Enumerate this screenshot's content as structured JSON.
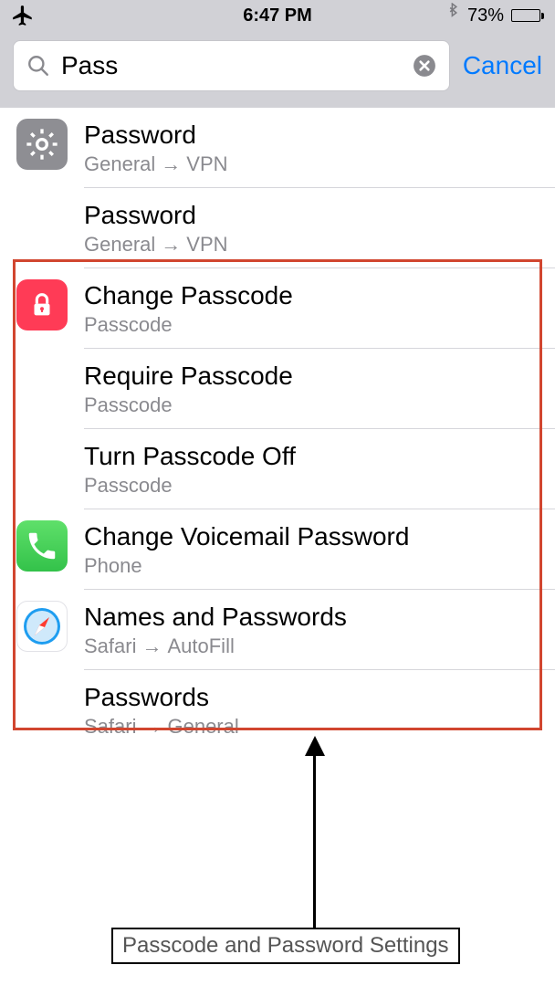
{
  "statusbar": {
    "time": "6:47 PM",
    "battery_percent": "73%"
  },
  "search": {
    "value": "Pass",
    "cancel": "Cancel"
  },
  "arrows": {
    "sep": "→"
  },
  "results": [
    {
      "icon": "gear",
      "title": "Password",
      "path1": "General",
      "path2": "VPN"
    },
    {
      "icon": "",
      "title": "Password",
      "path1": "General",
      "path2": "VPN"
    },
    {
      "icon": "lock",
      "title": "Change Passcode",
      "path1": "Passcode",
      "path2": ""
    },
    {
      "icon": "",
      "title": "Require Passcode",
      "path1": "Passcode",
      "path2": ""
    },
    {
      "icon": "",
      "title": "Turn Passcode Off",
      "path1": "Passcode",
      "path2": ""
    },
    {
      "icon": "phone",
      "title": "Change Voicemail Password",
      "path1": "Phone",
      "path2": ""
    },
    {
      "icon": "safari",
      "title": "Names and Passwords",
      "path1": "Safari",
      "path2": "AutoFill"
    },
    {
      "icon": "",
      "title": "Passwords",
      "path1": "Safari",
      "path2": "General"
    }
  ],
  "annotation": {
    "label": "Passcode and Password Settings"
  }
}
